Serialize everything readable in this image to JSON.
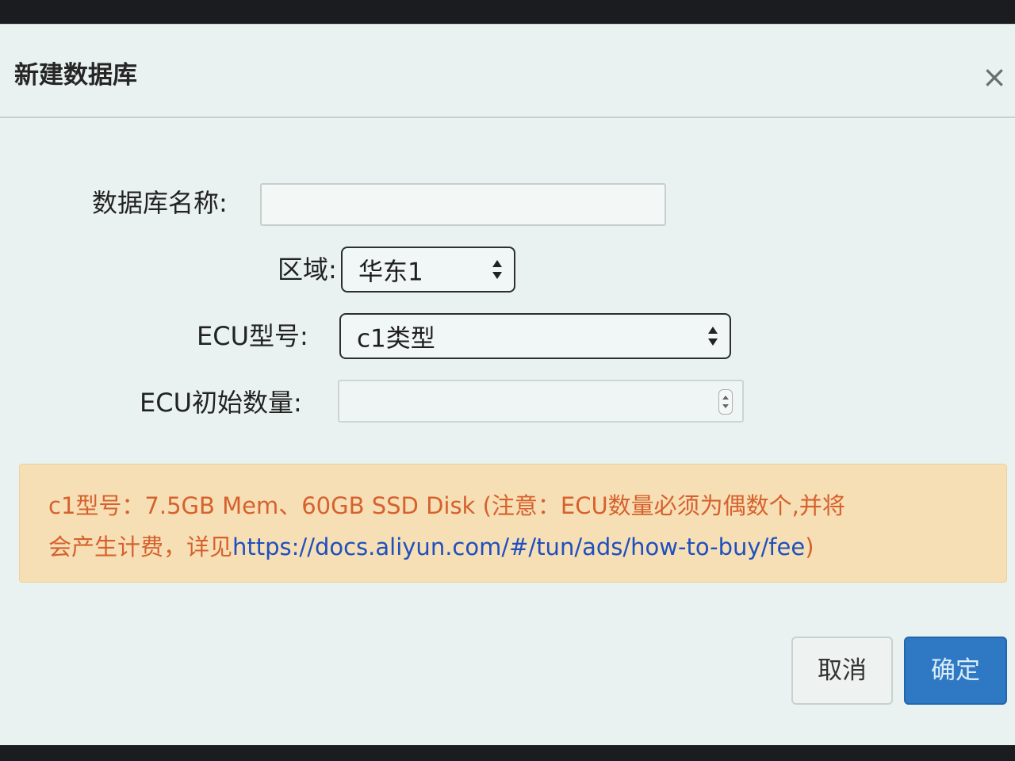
{
  "dialog": {
    "title": "新建数据库",
    "close_label": "×"
  },
  "form": {
    "db_name_label": "数据库名称:",
    "db_name_value": "",
    "region_label": "区域:",
    "region_value": "华东1",
    "ecu_type_label": "ECU型号:",
    "ecu_type_value": "c1类型",
    "ecu_count_label": "ECU初始数量:",
    "ecu_count_value": ""
  },
  "notice": {
    "line1": "c1型号：7.5GB Mem、60GB SSD Disk (注意：ECU数量必须为偶数个,并将",
    "line2_prefix": "会产生计费，详见",
    "link": "https://docs.aliyun.com/#/tun/ads/how-to-buy/fee",
    "line2_suffix": ")"
  },
  "footer": {
    "cancel_label": "取消",
    "confirm_label": "确定"
  },
  "colors": {
    "dialog_bg": "#e9f2f0",
    "notice_bg": "#f6dfb4",
    "notice_text": "#d6612e",
    "link": "#1f4fbf",
    "primary": "#2f78c4"
  }
}
